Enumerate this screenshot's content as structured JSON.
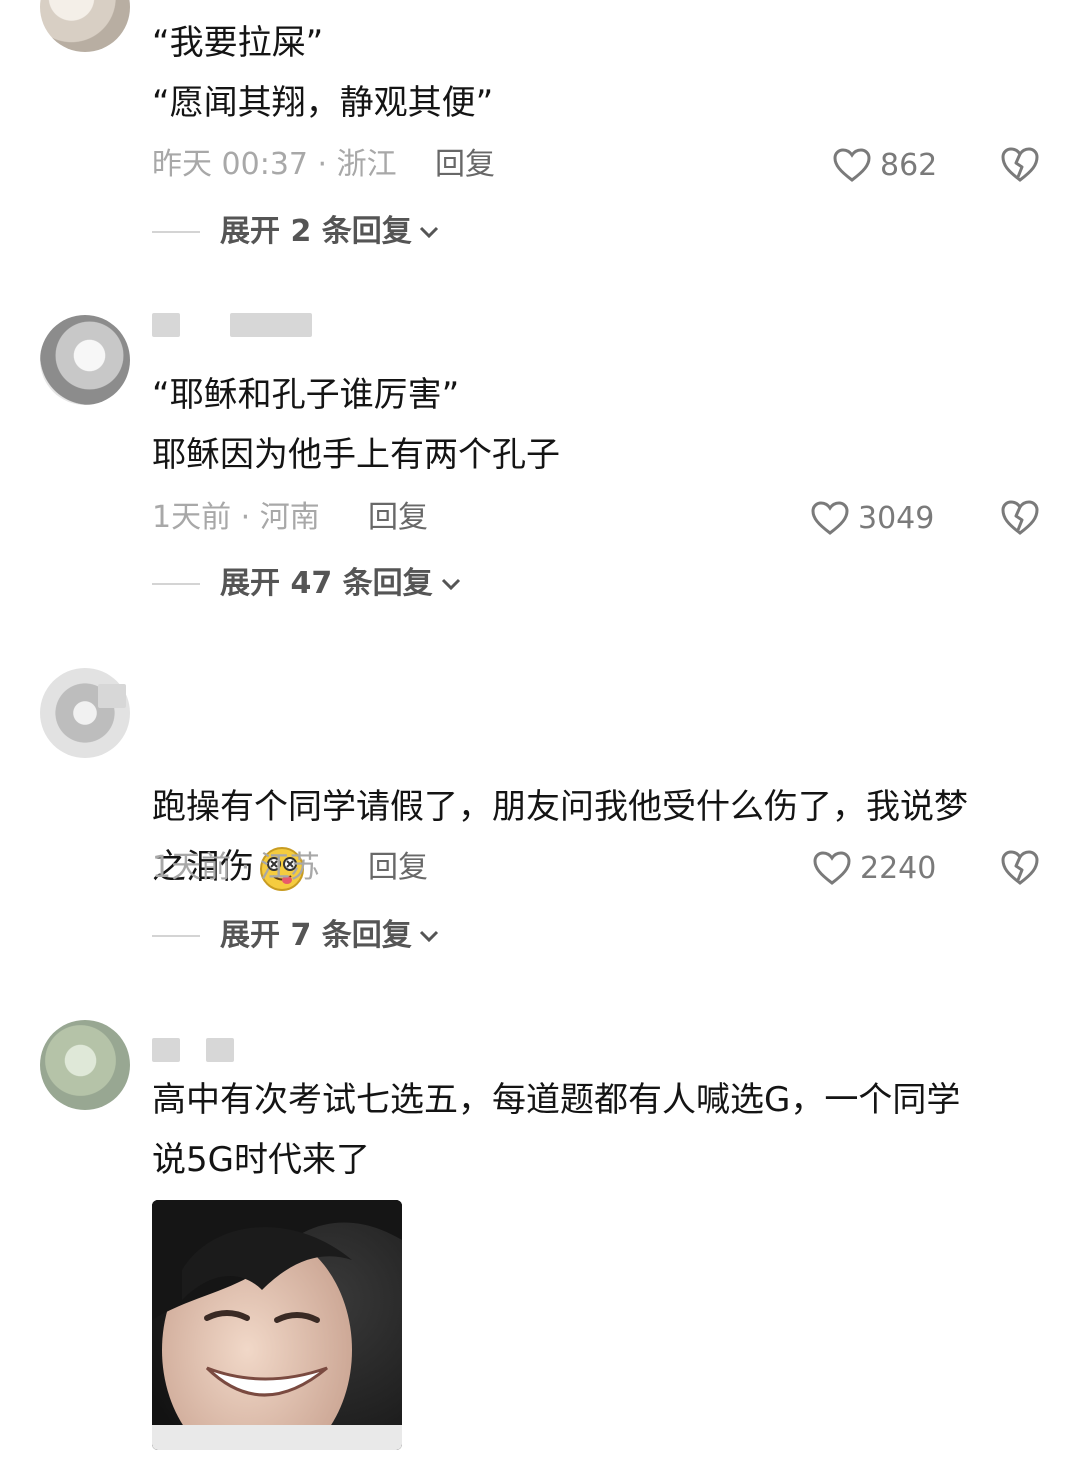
{
  "comments": [
    {
      "text": "“我要拉屎”\n“愿闻其翔，静观其便”",
      "time": "昨天 00:37 · 浙江",
      "reply": "回复",
      "likes": "862",
      "expand": "展开 2 条回复"
    },
    {
      "text": "“耶稣和孔子谁厉害”\n耶稣因为他手上有两个孔子",
      "time": "1天前 · 河南",
      "reply": "回复",
      "likes": "3049",
      "expand": "展开 47 条回复"
    },
    {
      "text": "跑操有个同学请假了，朋友问我他受什么伤了，我说梦\n之泪伤",
      "time": "1天前 · 江苏",
      "reply": "回复",
      "likes": "2240",
      "expand": "展开 7 条回复"
    },
    {
      "text": "高中有次考试七选五，每道题都有人喊选G，一个同学\n说5G时代来了",
      "time": "",
      "reply": "",
      "likes": "",
      "expand": ""
    }
  ],
  "icons": {
    "like": "heart-outline-icon",
    "dislike": "broken-heart-icon",
    "expand": "chevron-down-icon"
  },
  "colors": {
    "text": "#141414",
    "meta": "#a8a8a8",
    "reply": "#686868"
  }
}
